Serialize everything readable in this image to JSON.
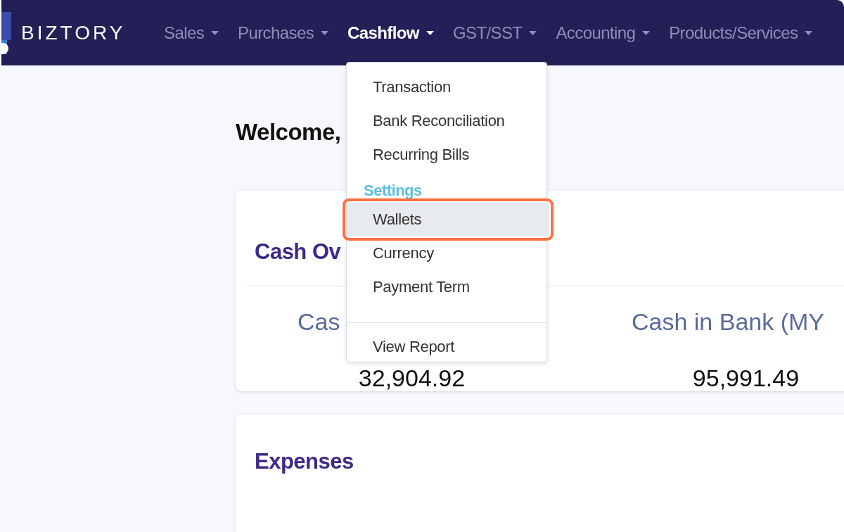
{
  "navbar": {
    "brand": "BIZTORY",
    "items": [
      {
        "label": "Sales",
        "selected": false
      },
      {
        "label": "Purchases",
        "selected": false
      },
      {
        "label": "Cashflow",
        "selected": true
      },
      {
        "label": "GST/SST",
        "selected": false
      },
      {
        "label": "Accounting",
        "selected": false
      },
      {
        "label": "Products/Services",
        "selected": false
      }
    ]
  },
  "dropdown": {
    "items": [
      {
        "kind": "item",
        "label": "Transaction",
        "highlighted": false
      },
      {
        "kind": "item",
        "label": "Bank Reconciliation",
        "highlighted": false
      },
      {
        "kind": "item",
        "label": "Recurring Bills",
        "highlighted": false
      },
      {
        "kind": "header",
        "label": "Settings"
      },
      {
        "kind": "item",
        "label": "Wallets",
        "highlighted": true
      },
      {
        "kind": "item",
        "label": "Currency",
        "highlighted": false
      },
      {
        "kind": "item",
        "label": "Payment Term",
        "highlighted": false
      },
      {
        "kind": "divider"
      },
      {
        "kind": "item",
        "label": "View Report",
        "highlighted": false
      }
    ]
  },
  "welcome": "Welcome,",
  "cash_card": {
    "title": "Cash Ov",
    "stats": [
      {
        "label": "Cas",
        "value": "32,904.92"
      },
      {
        "label": "Cash in Bank (MY",
        "value": "95,991.49"
      }
    ]
  },
  "expenses_card": {
    "title": "Expenses"
  }
}
